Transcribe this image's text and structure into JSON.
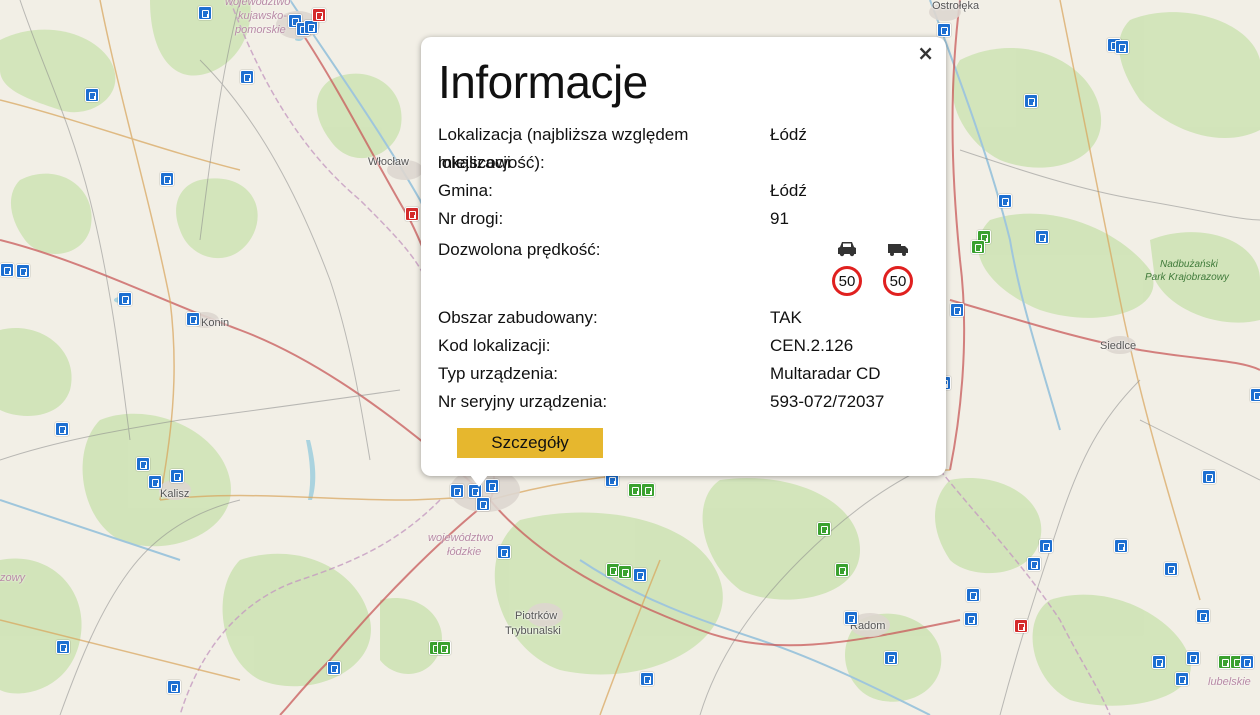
{
  "map": {
    "places": {
      "ostroleka": "Ostrołęka",
      "wloclawek": "Włocław",
      "konin": "Konin",
      "kalisz": "Kalisz",
      "siedlce": "Siedlce",
      "radom": "Radom",
      "piotrkow_1": "Piotrków",
      "piotrkow_2": "Trybunalski"
    },
    "regions": {
      "kujawsko_1": "województwo",
      "kujawsko_2": "kujawsko-",
      "kujawsko_3": "pomorskie",
      "lodzkie_1": "województwo",
      "lodzkie_2": "łódzkie",
      "lubelskie": "lubelskie",
      "left_edge": "zowy"
    },
    "parks": {
      "nadbuzanski_1": "Nadbużański",
      "nadbuzanski_2": "Park Krajobrazowy"
    },
    "colors": {
      "marker_blue": "#1d6fd1",
      "marker_green": "#3aa12f",
      "marker_red": "#d42b2b"
    }
  },
  "popup": {
    "title": "Informacje",
    "close_icon": "×",
    "rows": {
      "location_label_1": "Lokalizacja (najbliższa względem lokalizacji",
      "location_label_2": "miejscowość):",
      "location_value": "Łódź",
      "commune_label": "Gmina:",
      "commune_value": "Łódź",
      "road_label": "Nr drogi:",
      "road_value": "91",
      "speed_label": "Dozwolona prędkość:",
      "builtup_label": "Obszar zabudowany:",
      "builtup_value": "TAK",
      "code_label": "Kod lokalizacji:",
      "code_value": "CEN.2.126",
      "device_label": "Typ urządzenia:",
      "device_value": "Multaradar CD",
      "serial_label": "Nr seryjny urządzenia:",
      "serial_value": "593-072/72037"
    },
    "speed": {
      "car_icon": "car-icon",
      "truck_icon": "truck-icon",
      "car_limit": "50",
      "truck_limit": "50",
      "sign_color": "#e0201f"
    },
    "details_button": "Szczegóły",
    "details_button_color": "#e6b72e"
  }
}
